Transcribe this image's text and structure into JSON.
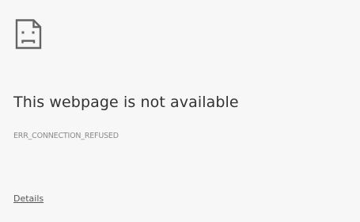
{
  "error": {
    "icon": "sad-page-icon",
    "title": "This webpage is not available",
    "code": "ERR_CONNECTION_REFUSED",
    "details_label": "Details"
  },
  "colors": {
    "background": "#f7f7f7",
    "title_text": "#333333",
    "code_text": "#8a8a8a",
    "link_text": "#555555",
    "icon_stroke": "#646464"
  }
}
